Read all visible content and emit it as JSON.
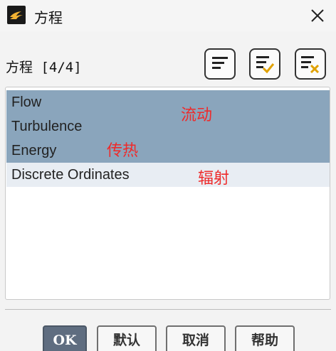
{
  "window": {
    "title": "方程",
    "app_icon": "ansys-logo-icon",
    "close_icon": "close-icon"
  },
  "toolbar": {
    "label": "方程 [4/4]",
    "buttons": [
      {
        "icon": "select-all-icon"
      },
      {
        "icon": "select-check-icon"
      },
      {
        "icon": "deselect-all-icon"
      }
    ]
  },
  "list": {
    "items": [
      {
        "label": "Flow",
        "state": "selected"
      },
      {
        "label": "Turbulence",
        "state": "selected"
      },
      {
        "label": "Energy",
        "state": "selected"
      },
      {
        "label": "Discrete Ordinates",
        "state": "current"
      }
    ]
  },
  "annotations": {
    "flow": "流动",
    "heat": "传热",
    "radiation": "辐射"
  },
  "buttons": {
    "ok": "OK",
    "default": "默认",
    "cancel": "取消",
    "help": "帮助"
  },
  "colors": {
    "selected_bg": "#8aa5bc",
    "annotation": "#ee2a2a",
    "ok_bg": "#5f6d80"
  }
}
